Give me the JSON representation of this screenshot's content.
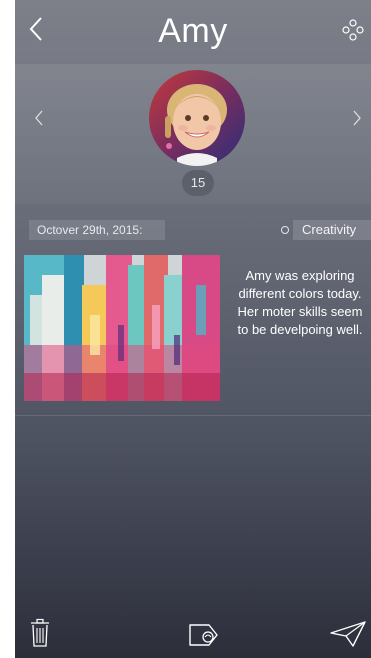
{
  "header": {
    "title": "Amy",
    "back_icon": "chevron-left-icon",
    "options_icon": "dots-cluster-icon"
  },
  "profile": {
    "avatar": "child-portrait",
    "count": "15",
    "prev_icon": "chevron-left-icon",
    "next_icon": "chevron-right-icon"
  },
  "entry": {
    "date": "Octover 29th, 2015:",
    "tag": "Creativity",
    "image": "abstract-painting",
    "note": "Amy was exploring different colors today. Her moter skills seem to be develpoing well."
  },
  "toolbar": {
    "trash_icon": "trash-icon",
    "tag_icon": "tag-icon",
    "send_icon": "send-icon"
  },
  "colors": {
    "bg_top": "#7d8089",
    "bg_bottom": "#2c2e3a",
    "text": "#ffffff"
  }
}
